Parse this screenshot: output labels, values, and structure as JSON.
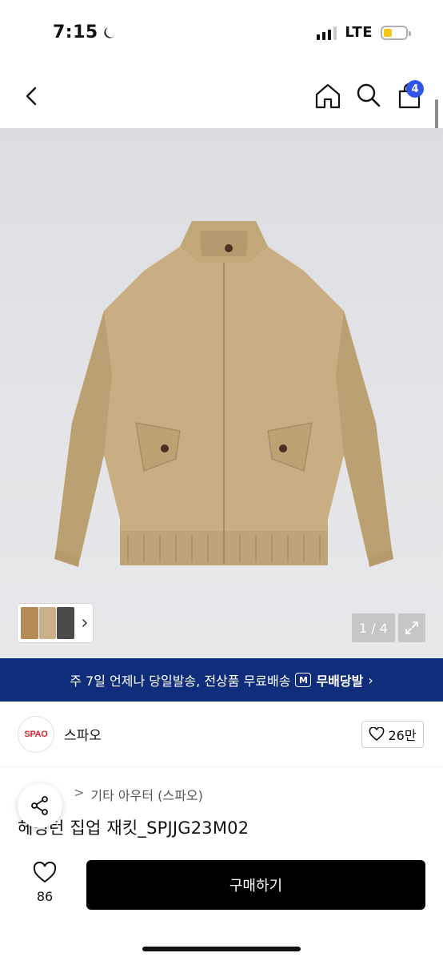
{
  "status_bar": {
    "time": "7:15",
    "network": "LTE",
    "icons": [
      "moon-icon",
      "signal-icon",
      "battery-icon"
    ]
  },
  "header": {
    "icons": [
      "back-icon",
      "home-icon",
      "search-icon",
      "shopping-bag-icon"
    ],
    "cart_count": "4"
  },
  "gallery": {
    "counter": "1 / 4",
    "icons": [
      "expand-icon",
      "chevron-right-icon"
    ],
    "thumbnail_colors": [
      "#b58b55",
      "#c9b08a",
      "#4b4b48"
    ]
  },
  "promo": {
    "text": "주 7일 언제나 당일발송, 전상품 무료배송",
    "badge": "M",
    "delivery_label": "무배당발",
    "chevron": "›",
    "color": "#0f2d7a"
  },
  "brand": {
    "logo_text": "SPAO",
    "name": "스파오",
    "likes": "26만"
  },
  "breadcrumb": {
    "items": [
      "기타 아우터 (스파오)"
    ],
    "separator": ">"
  },
  "product": {
    "title": "헤링턴 집업 재킷_SPJJG23M02"
  },
  "bottom_bar": {
    "wish_count": "86",
    "buy_label": "구매하기"
  },
  "colors": {
    "accent": "#2e55e6",
    "buy_button": "#000000",
    "jacket": "#c8ae82"
  }
}
